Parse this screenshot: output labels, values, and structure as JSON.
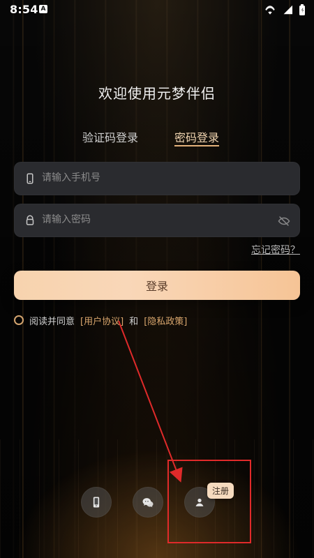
{
  "status_bar": {
    "time": "8:54",
    "app_indicator": "A"
  },
  "title": "欢迎使用元梦伴侣",
  "tabs": [
    {
      "label": "验证码登录",
      "selected": false
    },
    {
      "label": "密码登录",
      "selected": true
    }
  ],
  "fields": {
    "phone": {
      "placeholder": "请输入手机号",
      "value": ""
    },
    "password": {
      "placeholder": "请输入密码",
      "value": ""
    }
  },
  "forgot_password": "忘记密码？",
  "login_button": "登录",
  "agreement": {
    "prefix": "阅读并同意",
    "user_agreement": "[用户协议]",
    "and": "和",
    "privacy_policy": "[隐私政策]"
  },
  "bottom_actions": {
    "register_tag": "注册"
  },
  "colors": {
    "accent": "#e4b27b",
    "button_gradient_start": "#f7d3ae",
    "button_gradient_end": "#f6c496",
    "annotation_red": "#e02a2a"
  },
  "icons": {
    "phone": "phone-icon",
    "lock": "lock-icon",
    "eye_off": "eye-off-icon",
    "wechat": "wechat-icon",
    "user": "user-icon"
  }
}
